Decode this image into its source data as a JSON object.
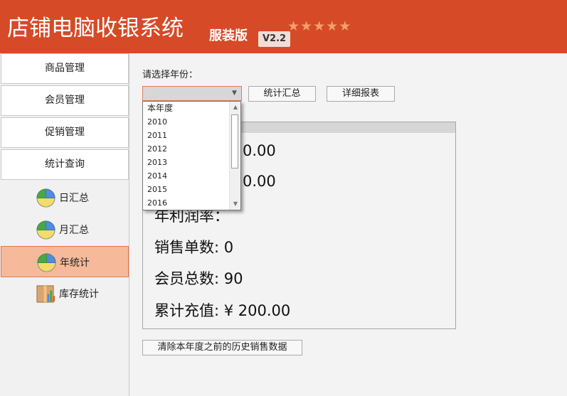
{
  "header": {
    "title": "店铺电脑收银系统",
    "edition": "服装版",
    "version": "V2.2",
    "rating": 5
  },
  "sidebar": {
    "menus": [
      {
        "label": "商品管理"
      },
      {
        "label": "会员管理"
      },
      {
        "label": "促销管理"
      },
      {
        "label": "统计查询"
      }
    ],
    "subitems": [
      {
        "label": "日汇总",
        "icon": "pie-chart-icon",
        "active": false
      },
      {
        "label": "月汇总",
        "icon": "pie-chart-icon",
        "active": false
      },
      {
        "label": "年统计",
        "icon": "pie-chart-icon",
        "active": true
      },
      {
        "label": "库存统计",
        "icon": "inventory-chart-icon",
        "active": false
      }
    ]
  },
  "main": {
    "year_prompt": "请选择年份：",
    "selected_year": "",
    "buttons": {
      "summary": "统计汇总",
      "details": "详细报表",
      "clear_history": "清除本年度之前的历史销售数据"
    },
    "stats": {
      "line1_value": "0.00",
      "line2_value": "0.00",
      "profit_rate": "年利润率：",
      "orders": "销售单数: 0",
      "members": "会员总数: 90",
      "topup": "累计充值: ¥ 200.00"
    },
    "year_options": [
      "本年度",
      "2010",
      "2011",
      "2012",
      "2013",
      "2014",
      "2015",
      "2016"
    ]
  },
  "colors": {
    "header": "#d64a27",
    "active_item": "#f6b99a",
    "active_border": "#de7950",
    "pie_blue": "#4f8de0",
    "pie_yellow": "#f3dc68",
    "pie_green": "#48a74b"
  }
}
